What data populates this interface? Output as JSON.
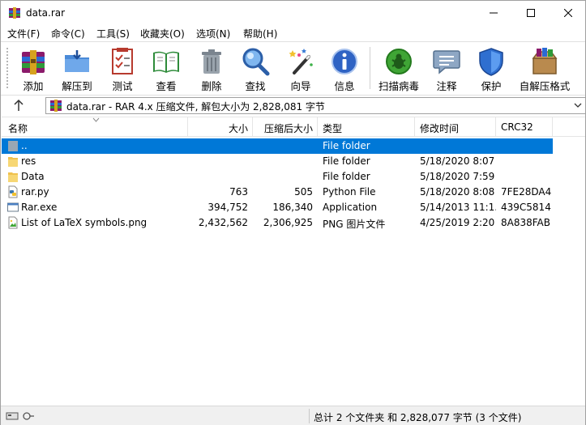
{
  "window": {
    "title": "data.rar",
    "accent": "#0078d7"
  },
  "menu": [
    {
      "label": "文件(F)"
    },
    {
      "label": "命令(C)"
    },
    {
      "label": "工具(S)"
    },
    {
      "label": "收藏夹(O)"
    },
    {
      "label": "选项(N)"
    },
    {
      "label": "帮助(H)"
    }
  ],
  "toolbar": [
    {
      "label": "添加",
      "icon": "add-archive-icon"
    },
    {
      "label": "解压到",
      "icon": "extract-to-icon"
    },
    {
      "label": "测试",
      "icon": "test-icon"
    },
    {
      "label": "查看",
      "icon": "view-book-icon"
    },
    {
      "label": "删除",
      "icon": "trash-icon"
    },
    {
      "label": "查找",
      "icon": "magnifier-icon"
    },
    {
      "label": "向导",
      "icon": "wizard-icon"
    },
    {
      "label": "信息",
      "icon": "info-icon"
    },
    {
      "label": "扫描病毒",
      "icon": "virus-scan-icon"
    },
    {
      "label": "注释",
      "icon": "comment-icon"
    },
    {
      "label": "保护",
      "icon": "shield-icon"
    },
    {
      "label": "自解压格式",
      "icon": "sfx-icon"
    }
  ],
  "address": {
    "text": "data.rar - RAR 4.x 压缩文件, 解包大小为 2,828,081 字节"
  },
  "columns": {
    "name": "名称",
    "size": "大小",
    "packed": "压缩后大小",
    "type": "类型",
    "modified": "修改时间",
    "crc": "CRC32"
  },
  "files": [
    {
      "name": "..",
      "size": "",
      "packed": "",
      "type": "File folder",
      "modified": "",
      "crc": "",
      "icon": "folder-up-icon",
      "selected": true
    },
    {
      "name": "res",
      "size": "",
      "packed": "",
      "type": "File folder",
      "modified": "5/18/2020 8:07 ...",
      "crc": "",
      "icon": "folder-icon",
      "selected": false
    },
    {
      "name": "Data",
      "size": "",
      "packed": "",
      "type": "File folder",
      "modified": "5/18/2020 7:59 ...",
      "crc": "",
      "icon": "folder-icon",
      "selected": false
    },
    {
      "name": "rar.py",
      "size": "763",
      "packed": "505",
      "type": "Python File",
      "modified": "5/18/2020 8:08 ...",
      "crc": "7FE28DA4",
      "icon": "python-file-icon",
      "selected": false
    },
    {
      "name": "Rar.exe",
      "size": "394,752",
      "packed": "186,340",
      "type": "Application",
      "modified": "5/14/2013 11:1...",
      "crc": "439C5814",
      "icon": "exe-file-icon",
      "selected": false
    },
    {
      "name": "List of LaTeX symbols.png",
      "size": "2,432,562",
      "packed": "2,306,925",
      "type": "PNG 图片文件",
      "modified": "4/25/2019 2:20 ...",
      "crc": "8A838FAB",
      "icon": "image-file-icon",
      "selected": false
    }
  ],
  "status": {
    "summary": "总计 2 个文件夹 和 2,828,077 字节 (3 个文件)"
  }
}
